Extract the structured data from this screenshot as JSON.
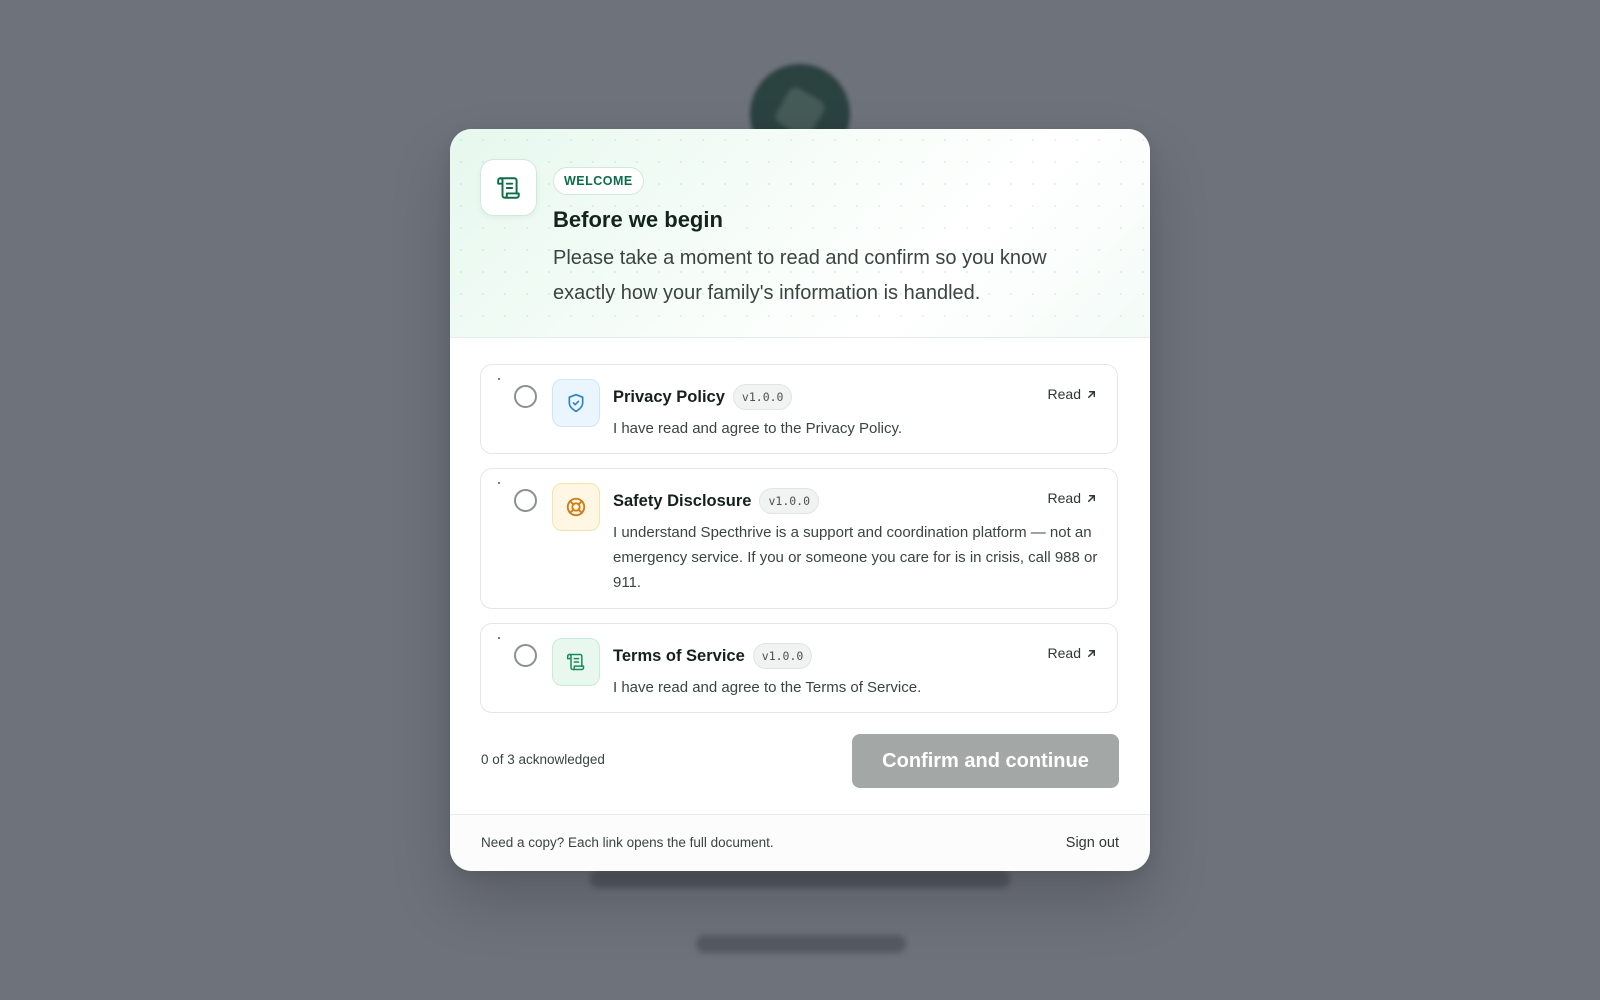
{
  "modal": {
    "badge": "WELCOME",
    "title": "Before we begin",
    "subtitle": "Please take a moment to read and confirm so you know exactly how your family's information is handled.",
    "header_icon": "scroll-icon"
  },
  "documents": [
    {
      "name": "Privacy Policy",
      "version": "v1.0.0",
      "description": "I have read and agree to the Privacy Policy.",
      "read_label": "Read",
      "icon": "shield-check-icon",
      "accent": "#2b86c5",
      "checked": false
    },
    {
      "name": "Safety Disclosure",
      "version": "v1.0.0",
      "description": "I understand Specthrive is a support and coordination platform — not an emergency service. If you or someone you care for is in crisis, call 988 or 911.",
      "read_label": "Read",
      "icon": "lifebuoy-icon",
      "accent": "#d27a16",
      "checked": false
    },
    {
      "name": "Terms of Service",
      "version": "v1.0.0",
      "description": "I have read and agree to the Terms of Service.",
      "read_label": "Read",
      "icon": "scroll-icon",
      "accent": "#1a8a5a",
      "checked": false
    }
  ],
  "progress": {
    "acknowledged_text": "0 of 3 acknowledged",
    "acknowledged": 0,
    "total": 3
  },
  "actions": {
    "confirm_label": "Confirm and continue",
    "confirm_enabled": false
  },
  "footer": {
    "note": "Need a copy? Each link opens the full document.",
    "signout_label": "Sign out"
  },
  "colors": {
    "brand": "#0d6e46",
    "overlay": "#6e727b",
    "button_disabled": "#a3a8a6"
  }
}
